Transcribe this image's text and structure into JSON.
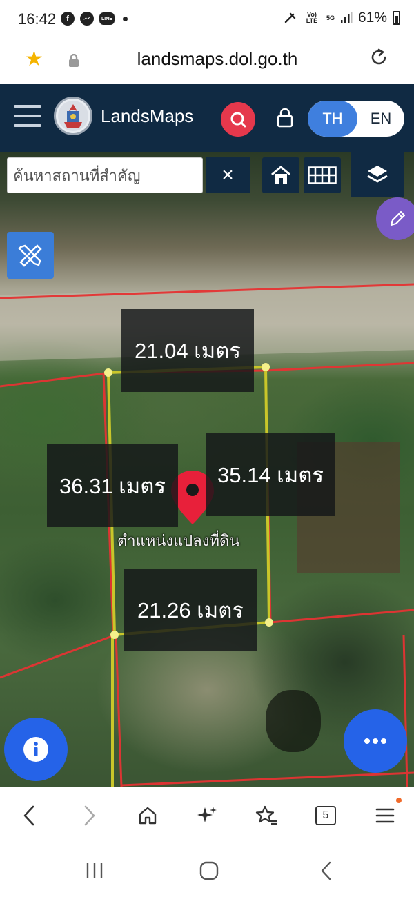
{
  "status_bar": {
    "time": "16:42",
    "app_icons": [
      "facebook-icon",
      "messenger-icon",
      "line-icon"
    ],
    "line_label": "LINE",
    "network_volte": "Vo) LTE",
    "network_5g": "5G",
    "battery_percent": "61%"
  },
  "browser": {
    "url": "landsmaps.dol.go.th"
  },
  "header": {
    "brand": "LandsMaps",
    "lang_th": "TH",
    "lang_en": "EN",
    "active_lang": "TH"
  },
  "map": {
    "search_placeholder": "ค้นหาสถานที่สำคัญ",
    "clear_symbol": "×",
    "measurements": {
      "top": "21.04 เมตร",
      "left": "36.31 เมตร",
      "right": "35.14 เมตร",
      "bottom": "21.26 เมตร"
    },
    "pin_label": "ตำแหน่งแปลงที่ดิน",
    "info_symbol": "i",
    "more_symbol": "•••"
  },
  "browser_toolbar": {
    "tab_count": "5"
  },
  "colors": {
    "header_bg": "#102a43",
    "search_red": "#e5384c",
    "lang_active": "#3f7fde",
    "fab_blue": "#2563e8",
    "parcel_outline": "#c9c62a",
    "parcel_boundaries": "#e53333",
    "pin_red": "#e8203a"
  }
}
